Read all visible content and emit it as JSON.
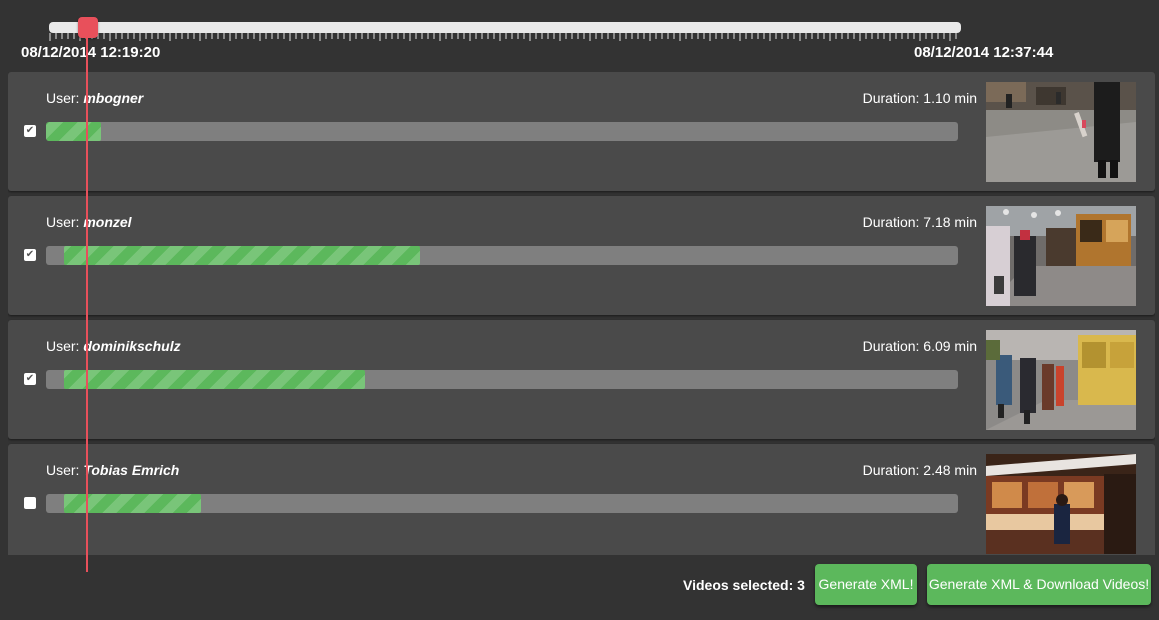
{
  "timeline": {
    "start_time": "08/12/2014 12:19:20",
    "end_time": "08/12/2014 12:37:44",
    "handle_position": 0.04
  },
  "user_prefix": "User: ",
  "duration_prefix": "Duration: ",
  "videos": [
    {
      "user": "mbogner",
      "duration": "1.10 min",
      "checked": true,
      "bar_start": 0.0,
      "bar_end": 0.06,
      "thumbnail": "street-market-walking-person-thumbnail"
    },
    {
      "user": "monzel",
      "duration": "7.18 min",
      "checked": true,
      "bar_start": 0.02,
      "bar_end": 0.41,
      "thumbnail": "christmas-market-stalls-thumbnail"
    },
    {
      "user": "dominikschulz",
      "duration": "6.09 min",
      "checked": true,
      "bar_start": 0.02,
      "bar_end": 0.35,
      "thumbnail": "market-crowd-wooden-huts-thumbnail"
    },
    {
      "user": "Tobias Emrich",
      "duration": "2.48 min",
      "checked": false,
      "bar_start": 0.02,
      "bar_end": 0.17,
      "thumbnail": "food-stall-night-thumbnail"
    }
  ],
  "footer": {
    "selected_label": "Videos selected: 3",
    "generate_xml": "Generate XML!",
    "generate_xml_download": "Generate XML & Download Videos!"
  },
  "colors": {
    "background": "#333333",
    "row_background": "#4a4a4a",
    "progress_fill": "#5cb85c",
    "progress_track": "#7f7f7f",
    "playhead": "#e8505b",
    "button": "#5cb85c"
  }
}
